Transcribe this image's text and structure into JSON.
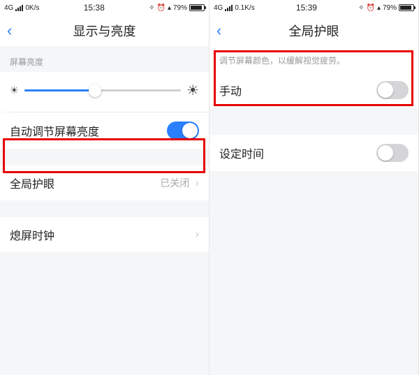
{
  "left": {
    "status": {
      "net_type": "4G",
      "speed": "0K/s",
      "time": "15:38",
      "battery_pct": "79%",
      "battery_fill_pct": 79
    },
    "nav": {
      "title": "显示与亮度"
    },
    "brightness_label": "屏幕亮度",
    "brightness_pct": 45,
    "rows": {
      "auto_brightness": {
        "label": "自动调节屏幕亮度",
        "on": true
      },
      "eye_protect": {
        "label": "全局护眼",
        "value": "已关闭"
      },
      "aod": {
        "label": "熄屏时钟"
      }
    }
  },
  "right": {
    "status": {
      "net_type": "4G",
      "speed": "0.1K/s",
      "time": "15:39",
      "battery_pct": "79%",
      "battery_fill_pct": 79
    },
    "nav": {
      "title": "全局护眼"
    },
    "hint": "调节屏幕颜色，以缓解视觉疲劳。",
    "rows": {
      "manual": {
        "label": "手动",
        "on": false
      },
      "schedule": {
        "label": "设定时间",
        "on": false
      }
    }
  }
}
